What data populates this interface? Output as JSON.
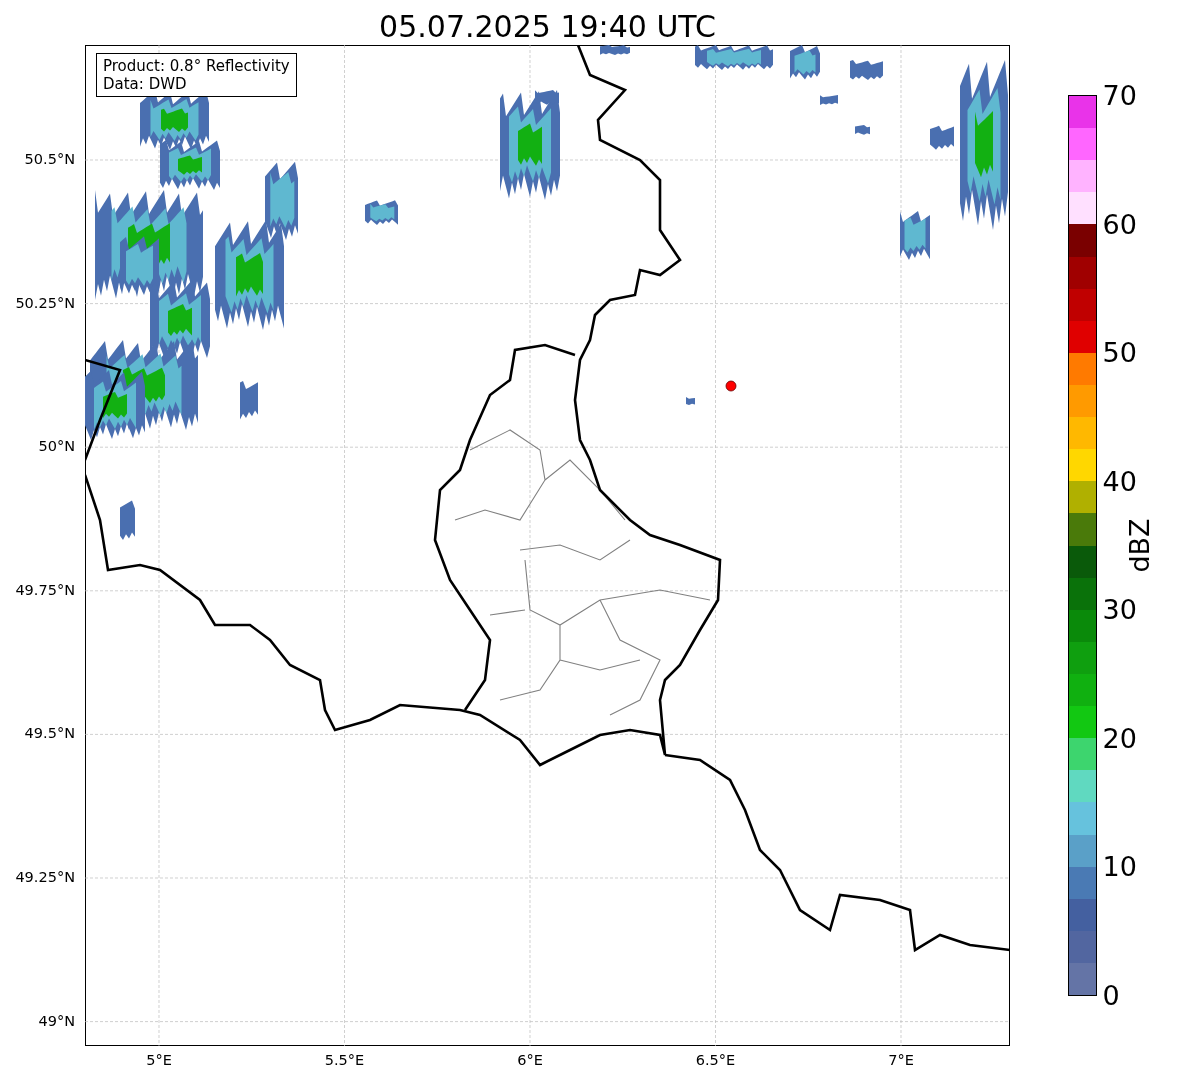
{
  "title": "05.07.2025 19:40 UTC",
  "info_box": [
    "Product: 0.8° Reflectivity",
    "Data: DWD"
  ],
  "x_axis": {
    "ticks": [
      "5°E",
      "5.5°E",
      "6°E",
      "6.5°E",
      "7°E"
    ]
  },
  "y_axis": {
    "ticks": [
      "50.5°N",
      "50.25°N",
      "50°N",
      "49.75°N",
      "49.5°N",
      "49.25°N",
      "49°N"
    ]
  },
  "colorbar": {
    "label": "dBZ",
    "ticks": [
      "70",
      "60",
      "50",
      "40",
      "30",
      "20",
      "10",
      "0"
    ]
  }
}
